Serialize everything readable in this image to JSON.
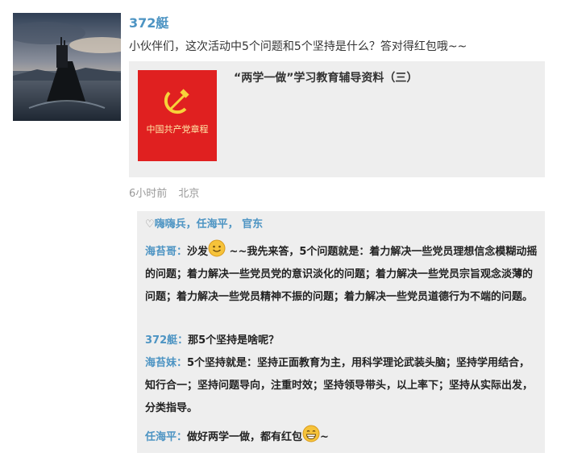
{
  "post": {
    "username": "372艇",
    "content": "小伙伴们，这次活动中5个问题和5个坚持是什么？答对得红包哦~~",
    "share": {
      "thumb_text": "中国共产党章程",
      "title": "“两学一做”学习教育辅导资料（三）"
    },
    "meta": {
      "time": "6小时前",
      "location": "北京"
    }
  },
  "likes": {
    "heart": "♡",
    "names": "嗨嗨兵，任海平， 官东"
  },
  "comments": [
    {
      "author": "海苔哥：",
      "before": "沙发",
      "emoji": "smile-emoji",
      "after": " ~~我先来答，5个问题就是：着力解决一些党员理想信念模糊动摇的问题；着力解决一些党员党的意识淡化的问题；着力解决一些党员宗旨观念淡薄的问题；着力解决一些党员精神不振的问题；着力解决一些党员道德行为不端的问题。"
    },
    {
      "author": "372艇：",
      "text": "那5个坚持是啥呢？"
    },
    {
      "author": "海苔妹：",
      "text": "5个坚持就是：坚持正面教育为主，用科学理论武装头脑；坚持学用结合，知行合一；坚持问题导向，注重时效；坚持领导带头，以上率下；坚持从实际出发，分类指导。"
    },
    {
      "author": "任海平：",
      "before": "做好两学一做，都有红包",
      "emoji": "grin-emoji",
      "after": "~"
    }
  ],
  "colors": {
    "link_blue": "#4d94c3",
    "card_bg": "#eeeeee",
    "meta_gray": "#999999",
    "party_red": "#e02020"
  }
}
